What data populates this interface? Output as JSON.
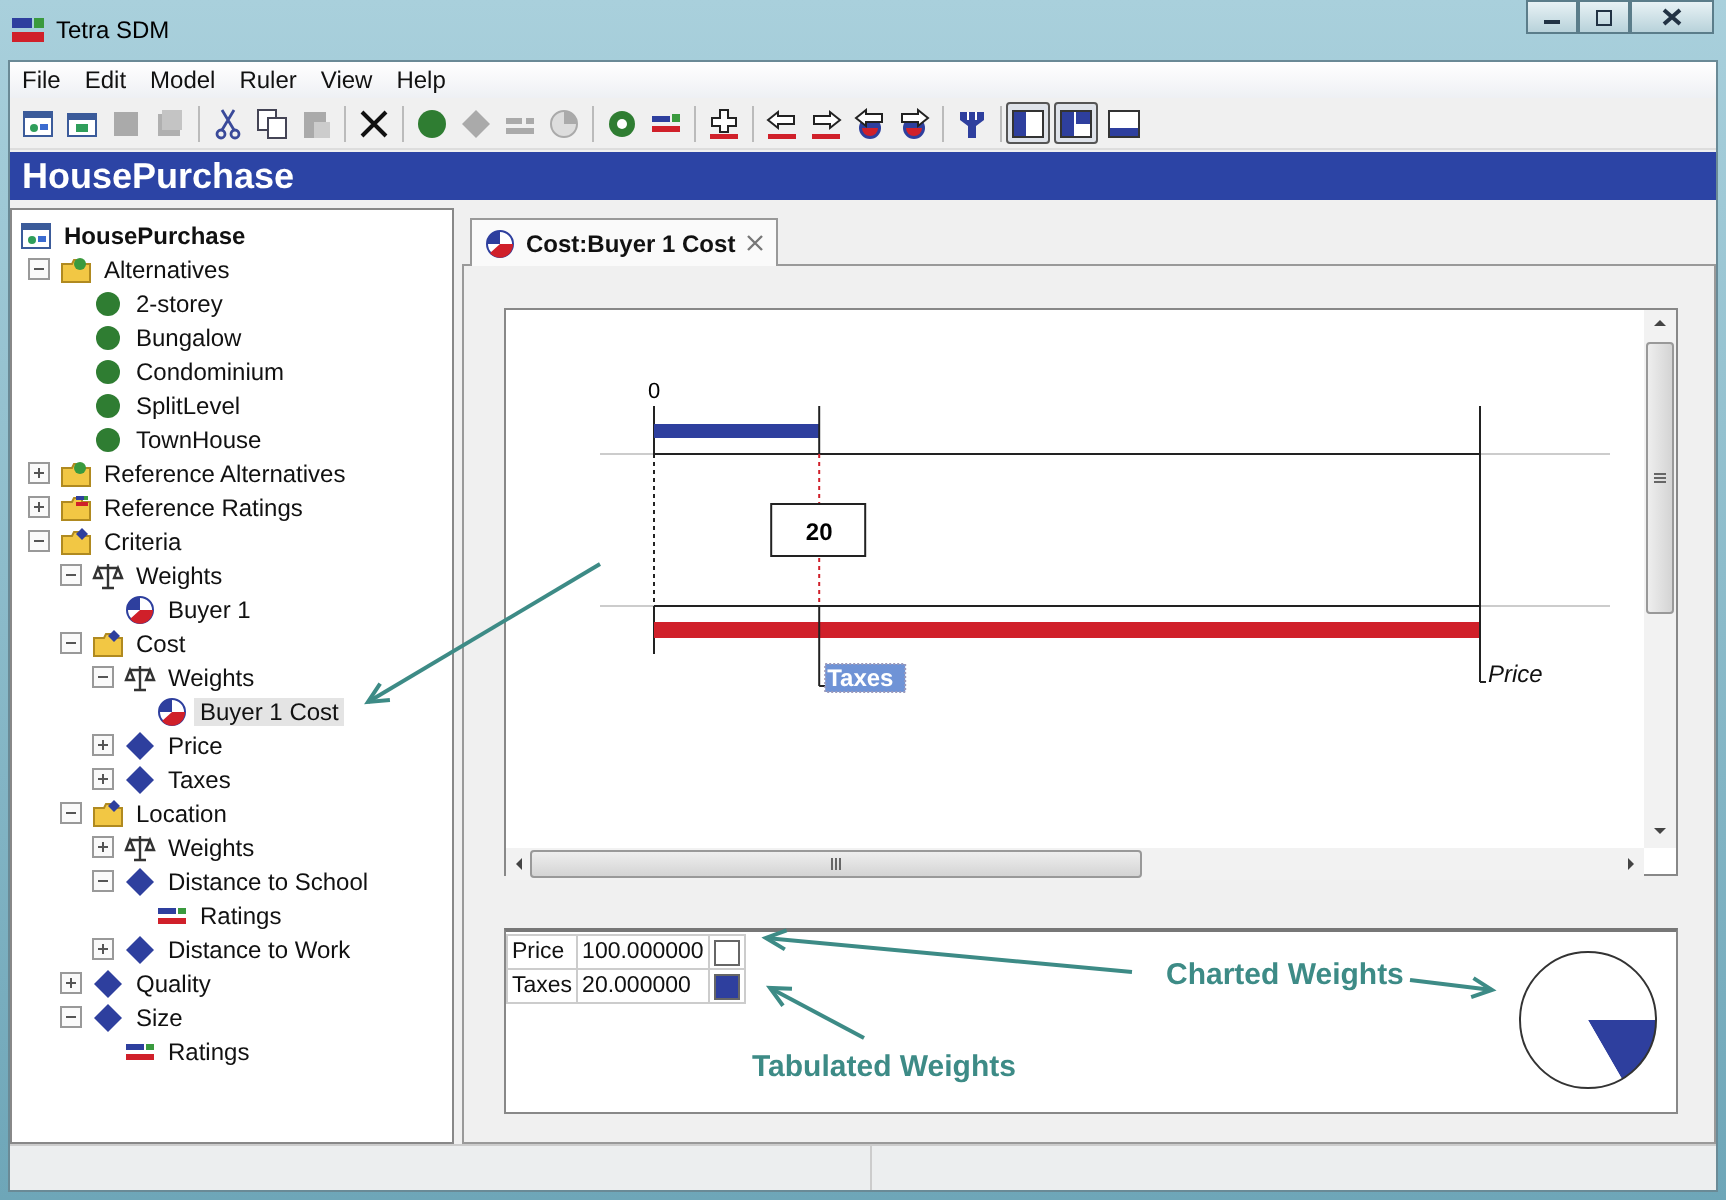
{
  "window": {
    "title": "Tetra SDM"
  },
  "menu": [
    "File",
    "Edit",
    "Model",
    "Ruler",
    "View",
    "Help"
  ],
  "toolbar": {
    "layout_buttons": [
      {
        "selected": true
      },
      {
        "selected": true
      },
      {
        "selected": false
      }
    ]
  },
  "banner": {
    "title": "HousePurchase"
  },
  "tree": {
    "label": "HousePurchase",
    "kind": "model",
    "selected": false,
    "children": [
      {
        "label": "Alternatives",
        "kind": "altfolder",
        "expanded": true,
        "selected": false,
        "children": [
          {
            "label": "2-storey",
            "kind": "alternative",
            "selected": false
          },
          {
            "label": "Bungalow",
            "kind": "alternative",
            "selected": false
          },
          {
            "label": "Condominium",
            "kind": "alternative",
            "selected": false
          },
          {
            "label": "SplitLevel",
            "kind": "alternative",
            "selected": false
          },
          {
            "label": "TownHouse",
            "kind": "alternative",
            "selected": false
          }
        ]
      },
      {
        "label": "Reference Alternatives",
        "kind": "altfolder",
        "expanded": false,
        "selected": false
      },
      {
        "label": "Reference Ratings",
        "kind": "ratefolder",
        "expanded": false,
        "selected": false
      },
      {
        "label": "Criteria",
        "kind": "critfolder",
        "expanded": true,
        "selected": false,
        "children": [
          {
            "label": "Weights",
            "kind": "weights",
            "expanded": true,
            "selected": false,
            "children": [
              {
                "label": "Buyer 1",
                "kind": "weightset",
                "selected": false
              }
            ]
          },
          {
            "label": "Cost",
            "kind": "critfolder",
            "expanded": true,
            "selected": false,
            "children": [
              {
                "label": "Weights",
                "kind": "weights",
                "expanded": true,
                "selected": false,
                "children": [
                  {
                    "label": "Buyer 1 Cost",
                    "kind": "weightset",
                    "selected": true
                  }
                ]
              },
              {
                "label": "Price",
                "kind": "criterion",
                "expanded": false,
                "selected": false
              },
              {
                "label": "Taxes",
                "kind": "criterion",
                "expanded": false,
                "selected": false
              }
            ]
          },
          {
            "label": "Location",
            "kind": "critfolder",
            "expanded": true,
            "selected": false,
            "children": [
              {
                "label": "Weights",
                "kind": "weights",
                "expanded": false,
                "selected": false
              },
              {
                "label": "Distance to School",
                "kind": "criterion",
                "expanded": true,
                "selected": false,
                "children": [
                  {
                    "label": "Ratings",
                    "kind": "ratings",
                    "selected": false
                  }
                ]
              },
              {
                "label": "Distance to Work",
                "kind": "criterion",
                "expanded": false,
                "selected": false
              }
            ]
          },
          {
            "label": "Quality",
            "kind": "criterion",
            "expanded": false,
            "selected": false
          },
          {
            "label": "Size",
            "kind": "criterion",
            "expanded": true,
            "selected": false,
            "children": [
              {
                "label": "Ratings",
                "kind": "ratings",
                "selected": false
              }
            ]
          }
        ]
      }
    ]
  },
  "tabs": [
    {
      "label": "Cost:Buyer 1 Cost",
      "selected": true
    }
  ],
  "ruler": {
    "origin_label": "0",
    "value_box": "20",
    "items": [
      {
        "label": "Taxes",
        "selected": true,
        "level": 0.2
      },
      {
        "label": "Price",
        "selected": false,
        "level": 1
      }
    ]
  },
  "weights_table": {
    "rows": [
      {
        "name": "Price",
        "value": "100.000000",
        "color": "#ffffff"
      },
      {
        "name": "Taxes",
        "value": "20.000000",
        "color": "#2e3f9e"
      }
    ]
  },
  "annotations": [
    {
      "text": "Charted Weights"
    },
    {
      "text": "Tabulated Weights"
    }
  ]
}
